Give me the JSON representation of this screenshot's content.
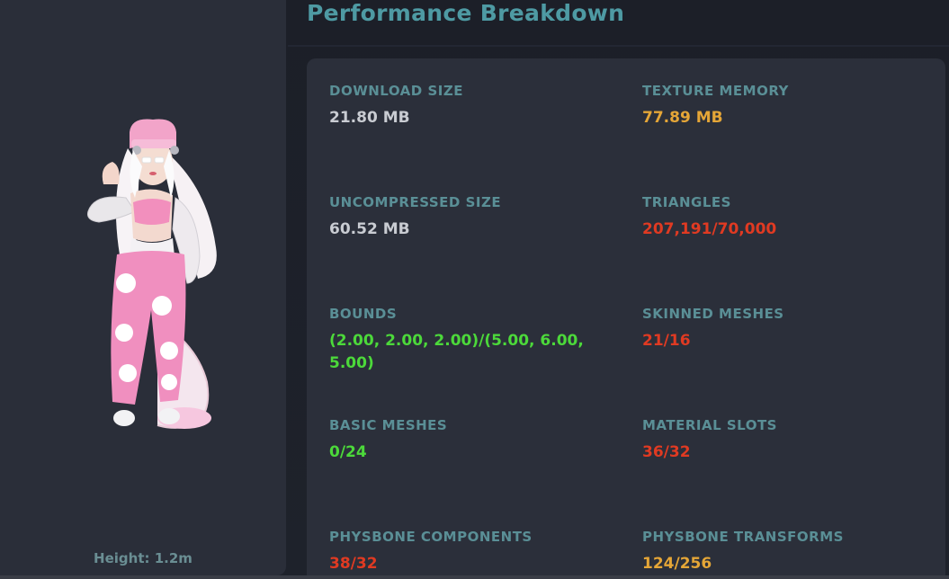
{
  "page": {
    "title": "Performance Breakdown"
  },
  "avatar": {
    "height_label": "Height: 1.2m"
  },
  "stats": [
    {
      "label": "DOWNLOAD SIZE",
      "value": "21.80 MB",
      "color": "#c9ccd2"
    },
    {
      "label": "TEXTURE MEMORY",
      "value": "77.89 MB",
      "color": "#e5a637"
    },
    {
      "label": "UNCOMPRESSED SIZE",
      "value": "60.52 MB",
      "color": "#c9ccd2"
    },
    {
      "label": "TRIANGLES",
      "value": "207,191/70,000",
      "color": "#e03a22"
    },
    {
      "label": "BOUNDS",
      "value": "(2.00, 2.00, 2.00)/(5.00, 6.00, 5.00)",
      "color": "#4cd93a"
    },
    {
      "label": "SKINNED MESHES",
      "value": "21/16",
      "color": "#e03a22"
    },
    {
      "label": "BASIC MESHES",
      "value": "0/24",
      "color": "#4cd93a"
    },
    {
      "label": "MATERIAL SLOTS",
      "value": "36/32",
      "color": "#e03a22"
    },
    {
      "label": "PHYSBONE COMPONENTS",
      "value": "38/32",
      "color": "#e03a22"
    },
    {
      "label": "PHYSBONE TRANSFORMS",
      "value": "124/256",
      "color": "#e5a637"
    }
  ]
}
